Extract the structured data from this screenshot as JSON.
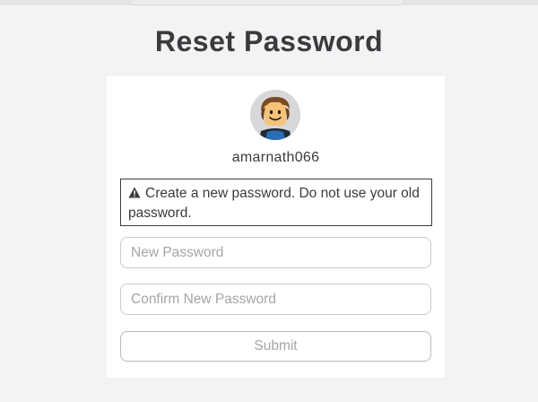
{
  "page": {
    "title": "Reset Password",
    "background": "#f2f3f5"
  },
  "user": {
    "username": "amarnath066",
    "avatar_icon": "avatar-icon"
  },
  "notice": {
    "icon": "warning-icon",
    "text": "Create a new password. Do not use your old password."
  },
  "form": {
    "new_password_placeholder": "New Password",
    "new_password_value": "",
    "confirm_password_placeholder": "Confirm New Password",
    "confirm_password_value": "",
    "submit_label": "Submit"
  },
  "colors": {
    "text": "#393b3d",
    "placeholder": "#a3a5a8",
    "card": "#ffffff",
    "border": "#c9cacc"
  }
}
